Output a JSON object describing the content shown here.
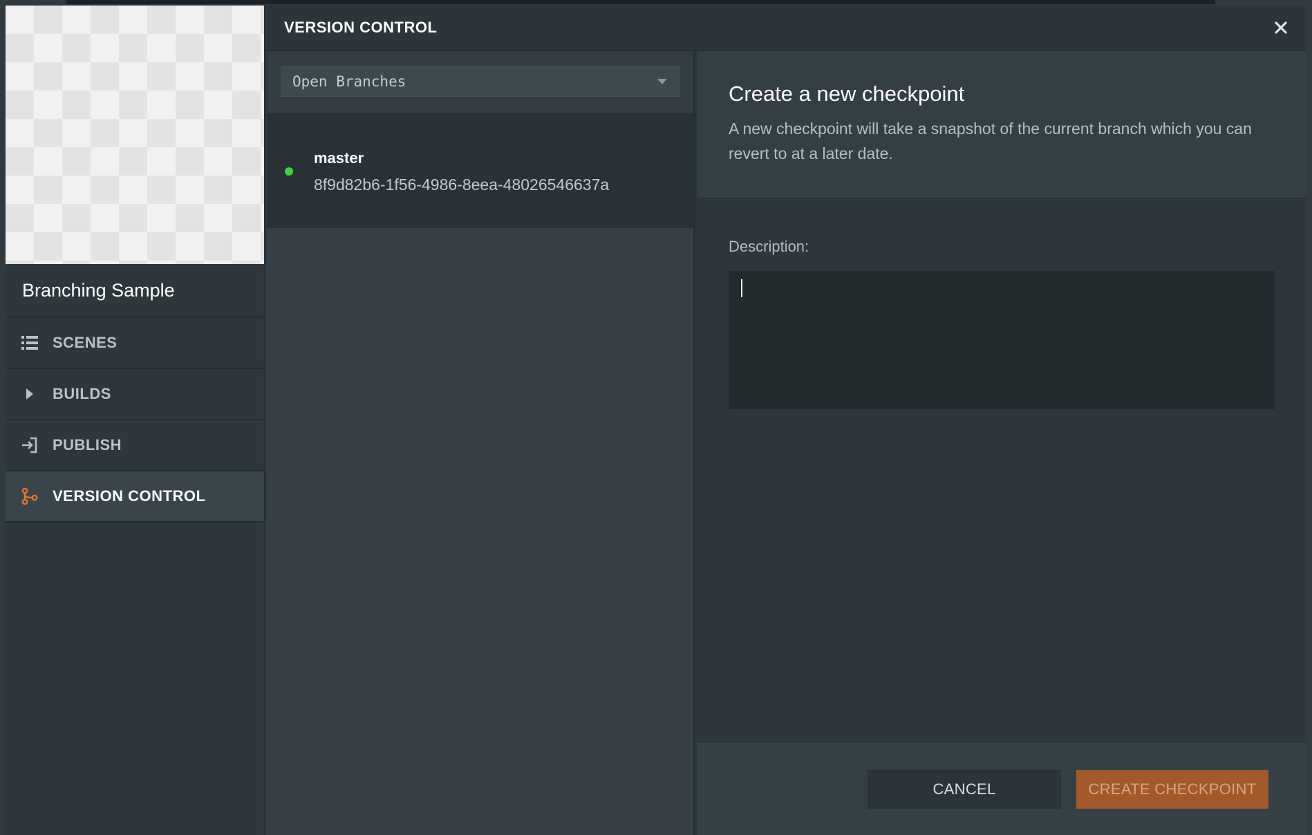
{
  "sidebar": {
    "project_name": "Branching Sample",
    "items": [
      {
        "label": "SCENES",
        "icon": "list-icon"
      },
      {
        "label": "BUILDS",
        "icon": "play-icon"
      },
      {
        "label": "PUBLISH",
        "icon": "publish-icon"
      },
      {
        "label": "VERSION CONTROL",
        "icon": "branch-icon"
      }
    ],
    "active_item": "VERSION CONTROL",
    "accent_color": "#e8742a"
  },
  "panel": {
    "title": "VERSION CONTROL"
  },
  "branches": {
    "filter_selected": "Open Branches",
    "items": [
      {
        "name": "master",
        "id": "8f9d82b6-1f56-4986-8eea-48026546637a",
        "status_color": "#3fd23f"
      }
    ]
  },
  "checkpoint": {
    "heading": "Create a new checkpoint",
    "description": "A new checkpoint will take a snapshot of the current branch which you can revert to at a later date.",
    "field_label": "Description:",
    "field_value": "",
    "cancel_label": "CANCEL",
    "create_label": "CREATE CHECKPOINT"
  }
}
